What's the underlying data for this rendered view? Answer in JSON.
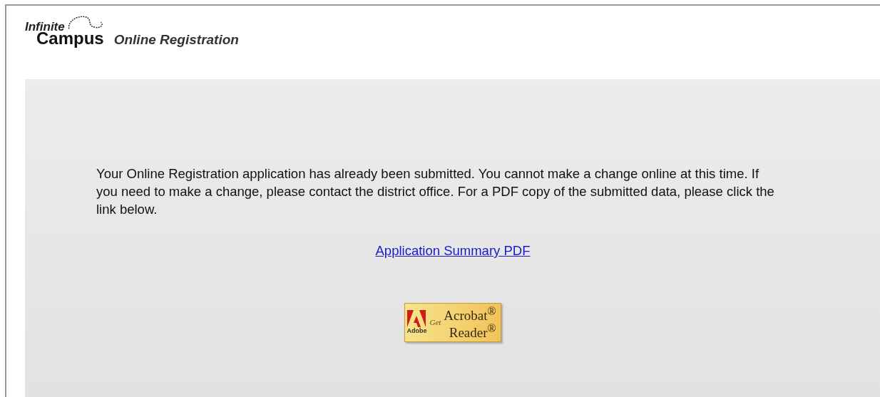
{
  "header": {
    "logo_top": "Infinite",
    "logo_bottom": "Campus",
    "app_name": "Online Registration"
  },
  "message": "Your Online Registration application has already been submitted. You cannot make a change online at this time. If you need to make a change, please contact the district office. For a PDF copy of the submitted data, please click the link below.",
  "link": "Application Summary PDF",
  "badge": {
    "brand": "Adobe",
    "get": "Get",
    "line_1": "Acrobat$^{®}$",
    "line_2": "Reader$^{®}$"
  }
}
